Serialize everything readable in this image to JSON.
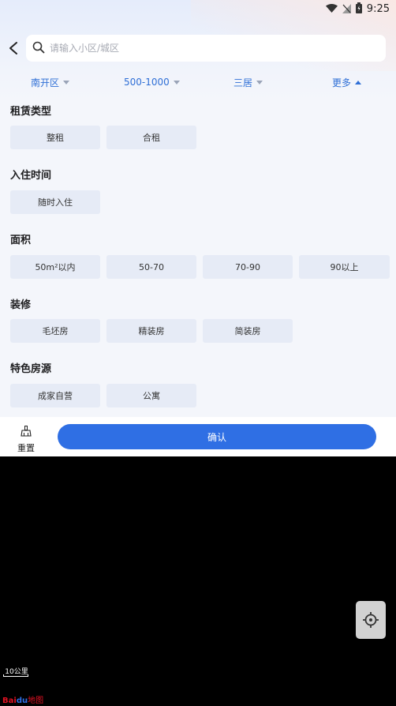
{
  "status_bar": {
    "time": "9:25"
  },
  "search": {
    "placeholder": "请输入小区/城区",
    "value": ""
  },
  "filters": [
    {
      "label": "南开区"
    },
    {
      "label": "500-1000"
    },
    {
      "label": "三居"
    },
    {
      "label": "更多"
    }
  ],
  "sections": {
    "rent_type": {
      "title": "租赁类型",
      "options": [
        "整租",
        "合租"
      ]
    },
    "move_in": {
      "title": "入住时间",
      "options": [
        "随时入住"
      ]
    },
    "area": {
      "title": "面积",
      "options": [
        "50m²以内",
        "50-70",
        "70-90",
        "90以上"
      ]
    },
    "decoration": {
      "title": "装修",
      "options": [
        "毛坯房",
        "精装房",
        "简装房"
      ]
    },
    "featured": {
      "title": "特色房源",
      "options": [
        "成家自营",
        "公寓"
      ]
    }
  },
  "bottom": {
    "reset_label": "重置",
    "confirm_label": "确认"
  },
  "map": {
    "scale_label": "10公里",
    "brand_b": "Bai",
    "brand_d": "du",
    "brand_m": "地图"
  },
  "colors": {
    "accent": "#2f6fe4",
    "chip_bg": "#e6ebf6"
  }
}
